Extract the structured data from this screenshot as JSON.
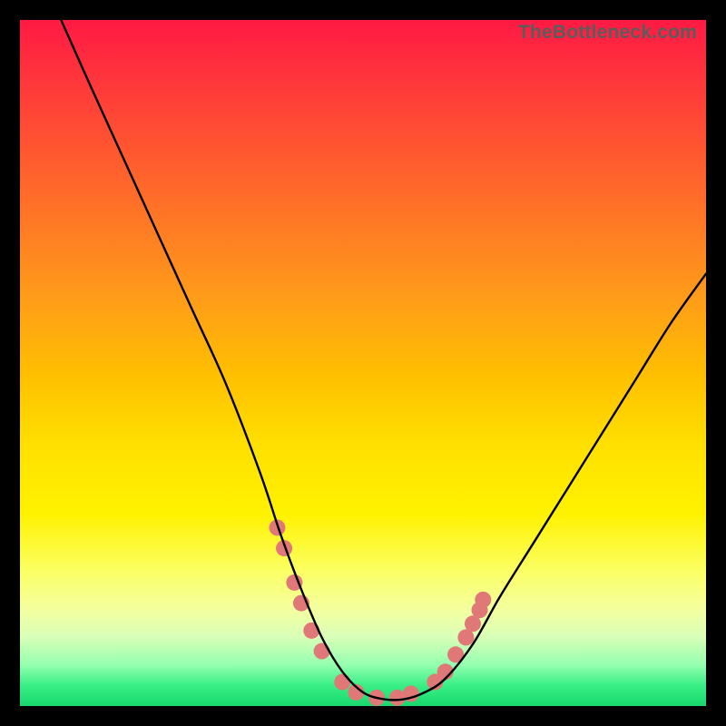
{
  "watermark": "TheBottleneck.com",
  "chart_data": {
    "type": "line",
    "title": "",
    "xlabel": "",
    "ylabel": "",
    "xlim": [
      0,
      100
    ],
    "ylim": [
      0,
      100
    ],
    "grid": false,
    "series": [
      {
        "name": "bottleneck-curve",
        "x": [
          6,
          10,
          15,
          20,
          25,
          30,
          35,
          38,
          41,
          44,
          47,
          50,
          53,
          56,
          59,
          62,
          66,
          70,
          75,
          80,
          85,
          90,
          95,
          100
        ],
        "y": [
          100,
          91,
          80,
          69,
          58,
          47,
          34,
          25,
          17,
          10,
          5,
          2,
          1,
          1,
          2,
          4,
          9,
          16,
          24,
          32,
          40,
          48,
          56,
          63
        ],
        "color": "#000000"
      }
    ],
    "markers": {
      "name": "highlight-dots",
      "color": "#e07878",
      "radius_px": 9,
      "points_xy": [
        [
          37.5,
          26
        ],
        [
          38.5,
          23
        ],
        [
          40,
          18
        ],
        [
          41,
          15
        ],
        [
          42.5,
          11
        ],
        [
          44,
          8
        ],
        [
          47,
          3.5
        ],
        [
          49,
          2
        ],
        [
          52,
          1.2
        ],
        [
          55,
          1.2
        ],
        [
          57,
          1.8
        ],
        [
          60.5,
          3.5
        ],
        [
          62,
          5
        ],
        [
          63.5,
          7.5
        ],
        [
          65,
          10
        ],
        [
          66,
          12
        ],
        [
          67,
          14
        ],
        [
          67.5,
          15.5
        ]
      ]
    },
    "background_gradient": {
      "top": "#ff1a44",
      "bottom": "#18d86d"
    }
  }
}
